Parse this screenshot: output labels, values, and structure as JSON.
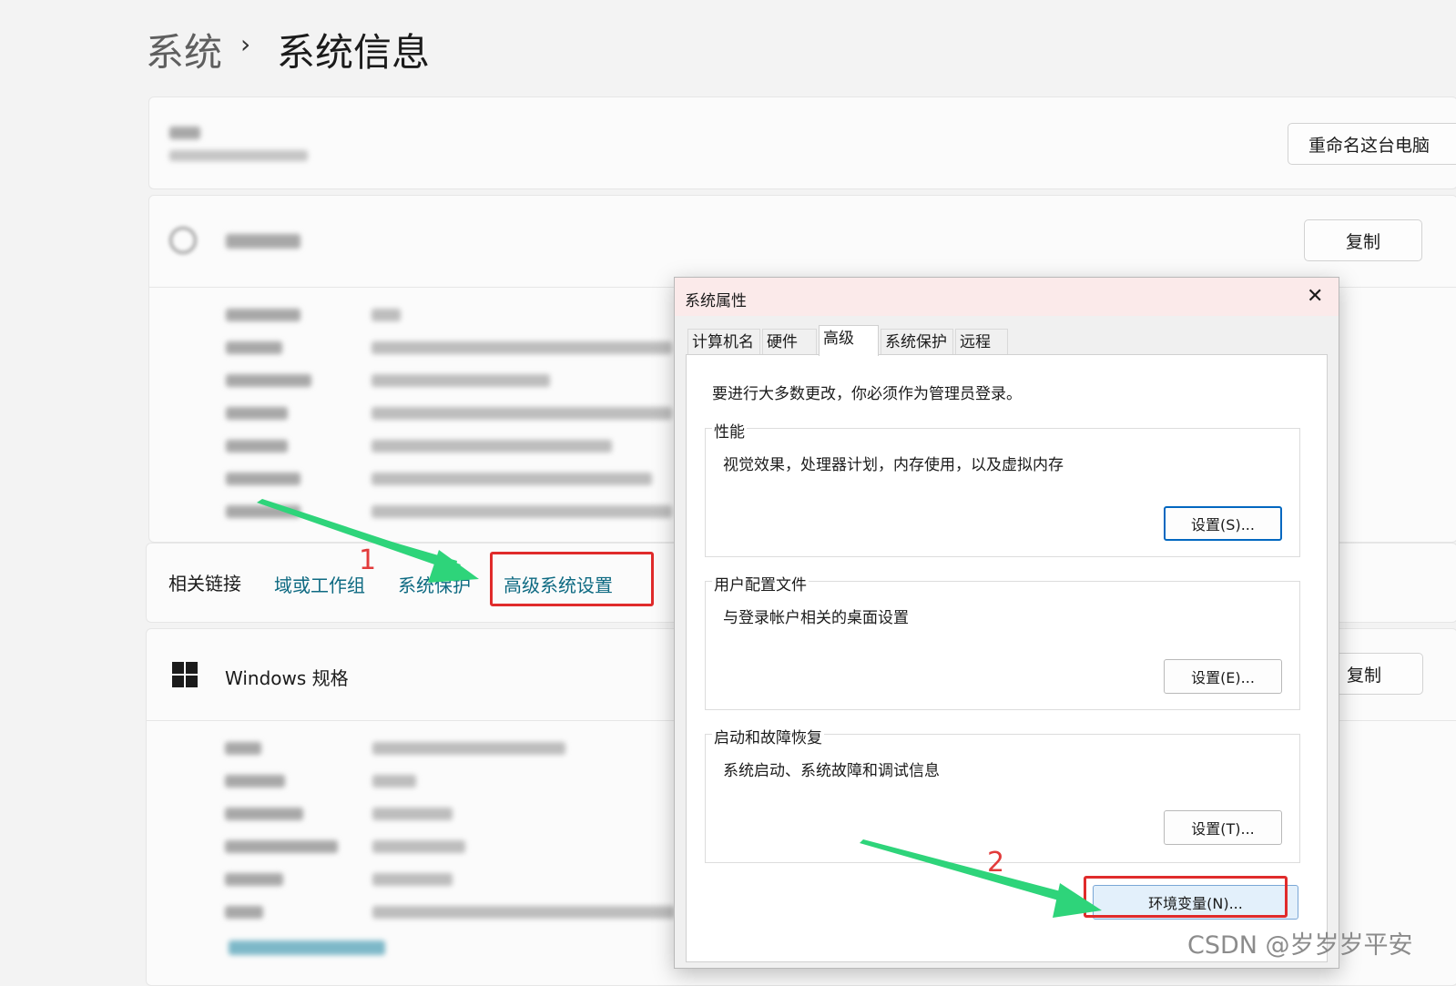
{
  "breadcrumb": {
    "parent": "系统",
    "separator": "›",
    "current": "系统信息"
  },
  "device_card": {
    "rename_button": "重命名这台电脑"
  },
  "device_spec": {
    "copy_button": "复制"
  },
  "related_links": {
    "label": "相关链接",
    "domain": "域或工作组",
    "protection": "系统保护",
    "advanced": "高级系统设置"
  },
  "windows_spec": {
    "title": "Windows 规格",
    "copy_button": "复制"
  },
  "dialog": {
    "title": "系统属性",
    "close": "✕",
    "tabs": [
      "计算机名",
      "硬件",
      "高级",
      "系统保护",
      "远程"
    ],
    "admin_note": "要进行大多数更改，你必须作为管理员登录。",
    "performance": {
      "label": "性能",
      "desc": "视觉效果，处理器计划，内存使用，以及虚拟内存",
      "button": "设置(S)..."
    },
    "profiles": {
      "label": "用户配置文件",
      "desc": "与登录帐户相关的桌面设置",
      "button": "设置(E)..."
    },
    "startup": {
      "label": "启动和故障恢复",
      "desc": "系统启动、系统故障和调试信息",
      "button": "设置(T)..."
    },
    "env_button": "环境变量(N)..."
  },
  "annotations": {
    "step1": "1",
    "step2": "2",
    "arrow_color": "#2ed47a",
    "highlight_color": "#e02b2b"
  },
  "watermark": "CSDN @岁岁岁平安"
}
